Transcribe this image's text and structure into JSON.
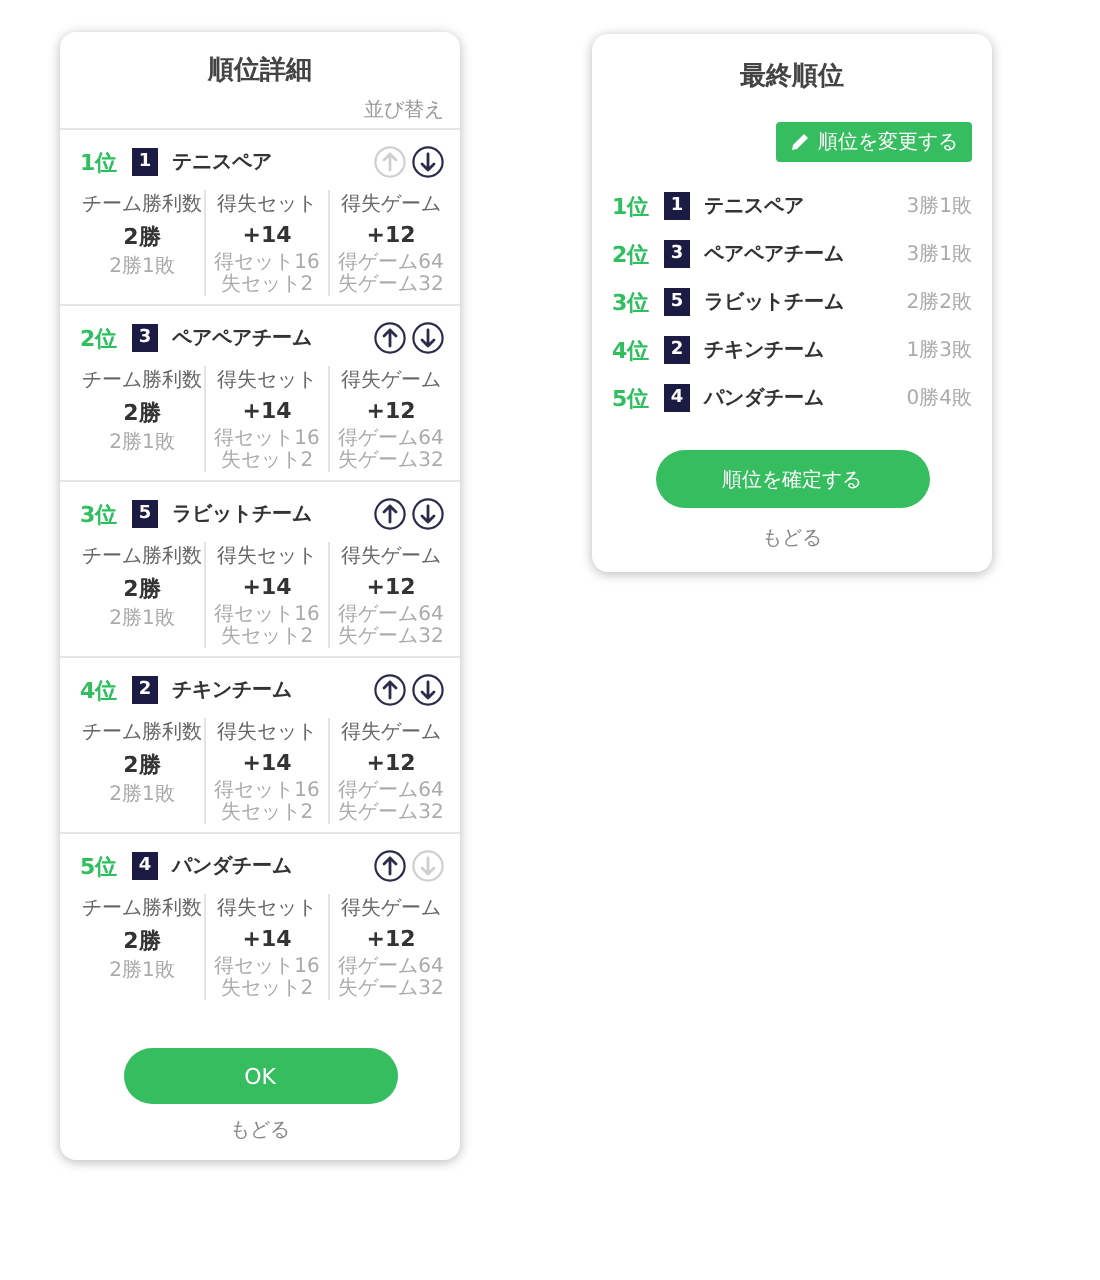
{
  "detail_panel": {
    "title": "順位詳細",
    "sort_label": "並び替え",
    "teams": [
      {
        "rank": "1位",
        "number": "1",
        "name": "テニスペア",
        "up_disabled": true,
        "down_disabled": false,
        "stats": [
          {
            "label": "チーム勝利数",
            "value": "2勝",
            "details": [
              "2勝1敗"
            ]
          },
          {
            "label": "得失セット",
            "value": "+14",
            "details": [
              "得セット16",
              "失セット2"
            ]
          },
          {
            "label": "得失ゲーム",
            "value": "+12",
            "details": [
              "得ゲーム64",
              "失ゲーム32"
            ]
          }
        ]
      },
      {
        "rank": "2位",
        "number": "3",
        "name": "ペアペアチーム",
        "up_disabled": false,
        "down_disabled": false,
        "stats": [
          {
            "label": "チーム勝利数",
            "value": "2勝",
            "details": [
              "2勝1敗"
            ]
          },
          {
            "label": "得失セット",
            "value": "+14",
            "details": [
              "得セット16",
              "失セット2"
            ]
          },
          {
            "label": "得失ゲーム",
            "value": "+12",
            "details": [
              "得ゲーム64",
              "失ゲーム32"
            ]
          }
        ]
      },
      {
        "rank": "3位",
        "number": "5",
        "name": "ラビットチーム",
        "up_disabled": false,
        "down_disabled": false,
        "stats": [
          {
            "label": "チーム勝利数",
            "value": "2勝",
            "details": [
              "2勝1敗"
            ]
          },
          {
            "label": "得失セット",
            "value": "+14",
            "details": [
              "得セット16",
              "失セット2"
            ]
          },
          {
            "label": "得失ゲーム",
            "value": "+12",
            "details": [
              "得ゲーム64",
              "失ゲーム32"
            ]
          }
        ]
      },
      {
        "rank": "4位",
        "number": "2",
        "name": "チキンチーム",
        "up_disabled": false,
        "down_disabled": false,
        "stats": [
          {
            "label": "チーム勝利数",
            "value": "2勝",
            "details": [
              "2勝1敗"
            ]
          },
          {
            "label": "得失セット",
            "value": "+14",
            "details": [
              "得セット16",
              "失セット2"
            ]
          },
          {
            "label": "得失ゲーム",
            "value": "+12",
            "details": [
              "得ゲーム64",
              "失ゲーム32"
            ]
          }
        ]
      },
      {
        "rank": "5位",
        "number": "4",
        "name": "パンダチーム",
        "up_disabled": false,
        "down_disabled": true,
        "stats": [
          {
            "label": "チーム勝利数",
            "value": "2勝",
            "details": [
              "2勝1敗"
            ]
          },
          {
            "label": "得失セット",
            "value": "+14",
            "details": [
              "得セット16",
              "失セット2"
            ]
          },
          {
            "label": "得失ゲーム",
            "value": "+12",
            "details": [
              "得ゲーム64",
              "失ゲーム32"
            ]
          }
        ]
      }
    ],
    "ok_button": "OK",
    "back_link": "もどる"
  },
  "final_panel": {
    "title": "最終順位",
    "edit_button": "順位を変更する",
    "rows": [
      {
        "rank": "1位",
        "number": "1",
        "name": "テニスペア",
        "record": "3勝1敗"
      },
      {
        "rank": "2位",
        "number": "3",
        "name": "ペアペアチーム",
        "record": "3勝1敗"
      },
      {
        "rank": "3位",
        "number": "5",
        "name": "ラビットチーム",
        "record": "2勝2敗"
      },
      {
        "rank": "4位",
        "number": "2",
        "name": "チキンチーム",
        "record": "1勝3敗"
      },
      {
        "rank": "5位",
        "number": "4",
        "name": "パンダチーム",
        "record": "0勝4敗"
      }
    ],
    "confirm_button": "順位を確定する",
    "back_link": "もどる"
  }
}
